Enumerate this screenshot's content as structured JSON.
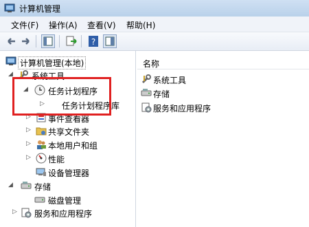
{
  "window": {
    "title": "计算机管理",
    "app_icon": "computer-management-icon"
  },
  "menu": [
    "文件(F)",
    "操作(A)",
    "查看(V)",
    "帮助(H)"
  ],
  "toolbar": {
    "buttons": [
      "back-arrow-icon",
      "forward-arrow-icon",
      "show-hide-tree-icon",
      "export-list-icon",
      "help-icon",
      "show-hide-action-pane-icon"
    ]
  },
  "tree": {
    "root": "计算机管理(本地)",
    "system_tools": "系统工具",
    "task_scheduler": "任务计划程序",
    "task_scheduler_library": "任务计划程序库",
    "event_viewer": "事件查看器",
    "shared_folders": "共享文件夹",
    "local_users_groups": "本地用户和组",
    "performance": "性能",
    "device_manager": "设备管理器",
    "storage": "存储",
    "disk_management": "磁盘管理",
    "services_apps": "服务和应用程序"
  },
  "list": {
    "header": "名称",
    "items": [
      "系统工具",
      "存储",
      "服务和应用程序"
    ]
  },
  "colors": {
    "highlight": "#e02020"
  }
}
